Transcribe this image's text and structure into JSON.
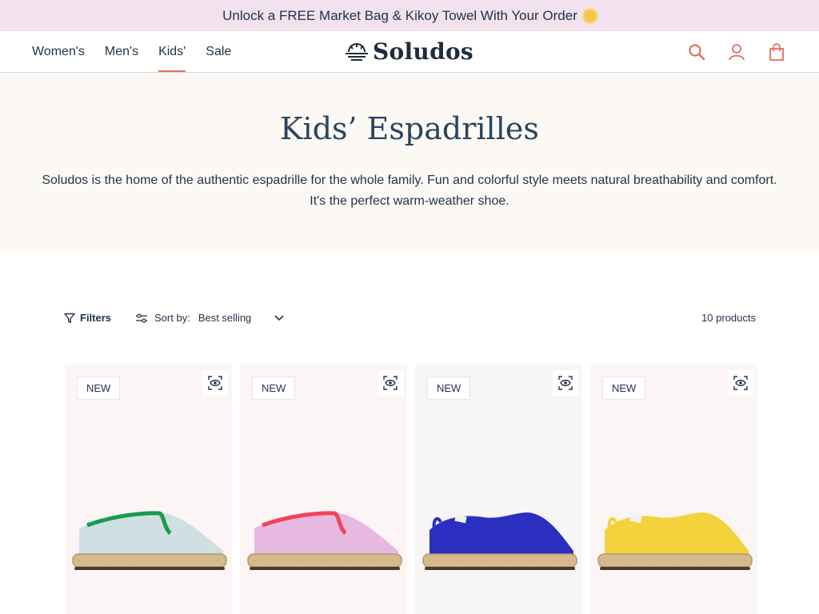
{
  "announcement": {
    "text": "Unlock a FREE Market Bag & Kikoy Towel With Your Order"
  },
  "nav": {
    "items": [
      "Women's",
      "Men's",
      "Kids'",
      "Sale"
    ],
    "active_index": 2
  },
  "brand": {
    "name": "Soludos"
  },
  "header_icons": [
    "search-icon",
    "account-icon",
    "cart-icon"
  ],
  "hero": {
    "title": "Kids’ Espadrilles",
    "description": "Soludos is the home of the authentic espadrille for the whole family. Fun and colorful style meets natural breathability and comfort. It's the perfect warm-weather shoe."
  },
  "toolbar": {
    "filters_label": "Filters",
    "sort_label": "Sort by:",
    "sort_value": "Best selling",
    "product_count": "10 products"
  },
  "products": [
    {
      "badge": "NEW",
      "bg": "#fbf5f6",
      "upper": "#cfe0e2",
      "trim": "#1a9a4e"
    },
    {
      "badge": "NEW",
      "bg": "#fbf5f6",
      "upper": "#e8b9e0",
      "trim": "#f0445a"
    },
    {
      "badge": "NEW",
      "bg": "#f7f5f5",
      "upper": "#2a2fc0",
      "trim": "#2a2fc0"
    },
    {
      "badge": "NEW",
      "bg": "#fbf5f6",
      "upper": "#f4d23b",
      "trim": "#f4d23b"
    }
  ],
  "colors": {
    "accent": "#e07060",
    "text": "#23334a",
    "hero_bg": "#fcf9f4",
    "announce_bg": "#f1e2ee"
  }
}
